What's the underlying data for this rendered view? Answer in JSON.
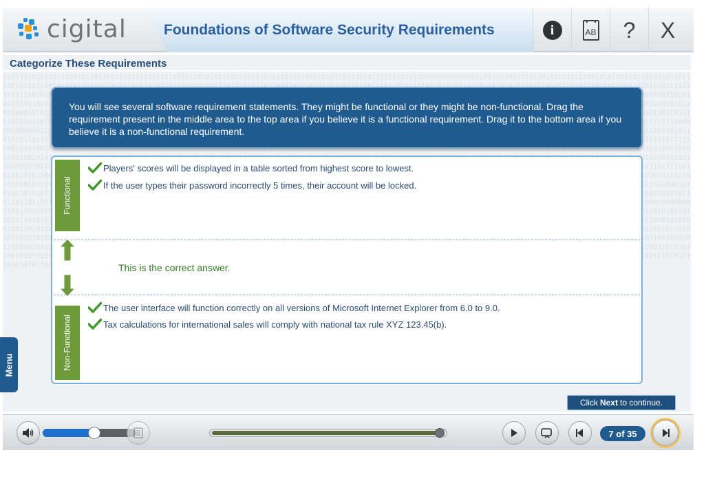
{
  "header": {
    "logo_text": "cigital",
    "course_title": "Foundations of Software Security Requirements",
    "info_label": "i",
    "glossary_label": "AB",
    "help_label": "?",
    "close_label": "X"
  },
  "section": {
    "title": "Categorize These Requirements"
  },
  "instructions": "You will see several software requirement statements. They might be functional or they might be non-functional. Drag the requirement  present in the middle area to the top area if you believe it is a functional requirement. Drag it to the bottom area if you believe it is a non-functional requirement.",
  "zones": {
    "functional_label": "Functional",
    "nonfunctional_label": "Non-Functional",
    "functional_items": [
      "Players' scores will be displayed in a table sorted from highest score to lowest.",
      "If the user types their password incorrectly 5 times, their account will be locked."
    ],
    "nonfunctional_items": [
      "The user interface will function correctly on all versions of Microsoft Internet Explorer from 6.0 to 9.0.",
      "Tax calculations for international sales will comply with national tax rule XYZ 123.45(b)."
    ]
  },
  "feedback": "This is the correct answer.",
  "menu_label": "Menu",
  "continue": {
    "prefix": "Click",
    "bold": "Next",
    "suffix": "to continue."
  },
  "footer": {
    "page_counter": "7 of 35",
    "volume_level": 0.55,
    "progress": 0.98
  },
  "binary_text": "0101101010110110101011011011111111111111110101101010110010101010101011001000101011010101011111111111100000000000001100100100101011010101111100010101001101101011011011010101101100101010110101010101101010101101101010101011010101011011010101010101101101101101110110101101011010101101101011010101101010100110101010110101011010101011111111111110101101010110010101010101011001000101011010101011111111111100000000000001100100100101011010101111100010101001101101011011011010101101100101010110101010101101010101101101010101011010101011011010101010101101101101101110110101101011010101101101011010101101010100110101010110101011010101011111111111110101101010110010101010101011001000101011010101011111111111100000000000001100100100101011010101111100010101001101101011011011010101101100101010110101010101101010101101101010101011010101011011010101010101101101101101110110101101011010101101101011010101101010100110101010110101011010101011111111111110101101010110010101010101011001000101011010101011111111111100000000000001100100100101011010101111100010101001101101011011011010101101100101010110101010101101010101101101010101011010101011011010101010101101101101101110110101101011010101101101011010101101010100110101010110101011010101011111111111110101101010110010101010101011001000101011010101011111111111100000000000001100100100101011010101111100010101001101101011011011010101101100101010110101010101101010101101101010101011010101011011010101010101101101101101110110101101011010101101101011010101101010100110101010110101011010101011111111111110101101010110010101010101011001000101011010101011111111111100000000000001100100100101011010101111100010101001101101011011011010101101100101010110101010101101010101101101010101011010101011011010101010101101101101101110110101101011010101101101011010101101010100110101010110101011010101011111111111110101101010110010101010101011001000101011010101011111111111100000000000001100100100101011010101111100010101001101101011011011010101101100101010110101010101101010101101101010101011010101011011010101010101101101101101110110101101011010101101101011010101101010100110101010110101011010101011111111111110101101010110010101010101011001000101011010101011111111111100000000000001100100100101011010101111100010101001101101011011011010101101100101010110101010101101010101101101010101011010101011011010101010101101101101101110110101101011010101101101011010101101010100110101010110101011010101011111111111110101101010110010101010101011001000101011010101011111111111100000000000001100100100101011010101111100010101001101101011011011010101101100101010110101010101101010101101101010101011010101011011010101010101101101101101110110101101011010101101101011010101101010100110101010110101011010101011111111111110101101010110010101010101011001000101011010101011111111111100000000000001100100100101011010101111100010101001101101011011011010101101100101010110101010101101010101101101010101011010101011011010101010101101101101101110110101101011010101101101011010101101010100110101010110101011010101011111111111110101101010110010101010101011001000101011010101011111111111100000000000001100100100101011010101111100010101001101101011011011010101101100101010110101010101101010101101101010101011010101011011010101010101101101101101110110101101011010101101101011010101101010100110101010110101011010101011111111111110101101010110010101010101011001000101011010101011111111111100000000000001100100100101011010101111100010101001101101011011011010101101100101010110101010101101010101101101010101011010101011011010101010101101101101101110110101101011010101101101011010101101010100"
}
